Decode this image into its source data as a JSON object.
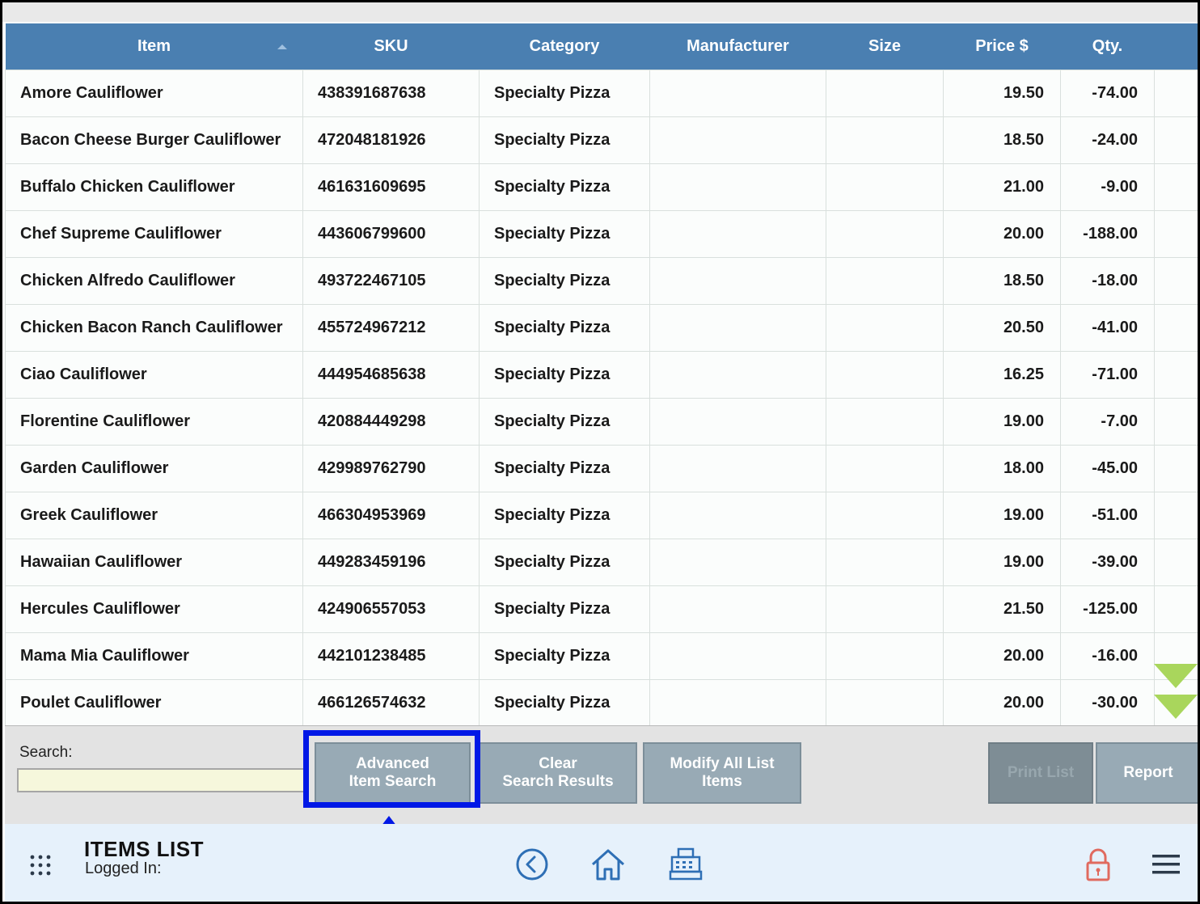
{
  "table": {
    "columns": [
      "Item",
      "SKU",
      "Category",
      "Manufacturer",
      "Size",
      "Price $",
      "Qty."
    ],
    "rows": [
      {
        "item": "Amore Cauliflower",
        "sku": "438391687638",
        "category": "Specialty Pizza",
        "manufacturer": "",
        "size": "",
        "price": "19.50",
        "qty": "-74.00"
      },
      {
        "item": "Bacon Cheese Burger Cauliflower",
        "sku": "472048181926",
        "category": "Specialty Pizza",
        "manufacturer": "",
        "size": "",
        "price": "18.50",
        "qty": "-24.00"
      },
      {
        "item": "Buffalo Chicken Cauliflower",
        "sku": "461631609695",
        "category": "Specialty Pizza",
        "manufacturer": "",
        "size": "",
        "price": "21.00",
        "qty": "-9.00"
      },
      {
        "item": "Chef Supreme Cauliflower",
        "sku": "443606799600",
        "category": "Specialty Pizza",
        "manufacturer": "",
        "size": "",
        "price": "20.00",
        "qty": "-188.00"
      },
      {
        "item": "Chicken Alfredo Cauliflower",
        "sku": "493722467105",
        "category": "Specialty Pizza",
        "manufacturer": "",
        "size": "",
        "price": "18.50",
        "qty": "-18.00"
      },
      {
        "item": "Chicken Bacon Ranch Cauliflower",
        "sku": "455724967212",
        "category": "Specialty Pizza",
        "manufacturer": "",
        "size": "",
        "price": "20.50",
        "qty": "-41.00"
      },
      {
        "item": "Ciao Cauliflower",
        "sku": "444954685638",
        "category": "Specialty Pizza",
        "manufacturer": "",
        "size": "",
        "price": "16.25",
        "qty": "-71.00"
      },
      {
        "item": "Florentine Cauliflower",
        "sku": "420884449298",
        "category": "Specialty Pizza",
        "manufacturer": "",
        "size": "",
        "price": "19.00",
        "qty": "-7.00"
      },
      {
        "item": "Garden Cauliflower",
        "sku": "429989762790",
        "category": "Specialty Pizza",
        "manufacturer": "",
        "size": "",
        "price": "18.00",
        "qty": "-45.00"
      },
      {
        "item": "Greek Cauliflower",
        "sku": "466304953969",
        "category": "Specialty Pizza",
        "manufacturer": "",
        "size": "",
        "price": "19.00",
        "qty": "-51.00"
      },
      {
        "item": "Hawaiian Cauliflower",
        "sku": "449283459196",
        "category": "Specialty Pizza",
        "manufacturer": "",
        "size": "",
        "price": "19.00",
        "qty": "-39.00"
      },
      {
        "item": "Hercules Cauliflower",
        "sku": "424906557053",
        "category": "Specialty Pizza",
        "manufacturer": "",
        "size": "",
        "price": "21.50",
        "qty": "-125.00"
      },
      {
        "item": "Mama Mia Cauliflower",
        "sku": "442101238485",
        "category": "Specialty Pizza",
        "manufacturer": "",
        "size": "",
        "price": "20.00",
        "qty": "-16.00"
      },
      {
        "item": "Poulet Cauliflower",
        "sku": "466126574632",
        "category": "Specialty Pizza",
        "manufacturer": "",
        "size": "",
        "price": "20.00",
        "qty": "-30.00"
      }
    ]
  },
  "search": {
    "label": "Search:",
    "value": ""
  },
  "buttons": {
    "advanced_search_line1": "Advanced",
    "advanced_search_line2": "Item Search",
    "clear_line1": "Clear",
    "clear_line2": "Search Results",
    "modify_line1": "Modify All List",
    "modify_line2": "Items",
    "print_list": "Print List",
    "report": "Report"
  },
  "footer": {
    "title": "ITEMS LIST",
    "subtitle": "Logged In:"
  },
  "colors": {
    "header": "#4a7fb1",
    "highlight": "#0018e6",
    "scroll_arrow": "#a9d65c",
    "lock_icon": "#e06a5f"
  },
  "icons": [
    "grid-menu-icon",
    "back-icon",
    "home-icon",
    "register-icon",
    "lock-icon",
    "hamburger-menu-icon",
    "scroll-down-icon"
  ]
}
